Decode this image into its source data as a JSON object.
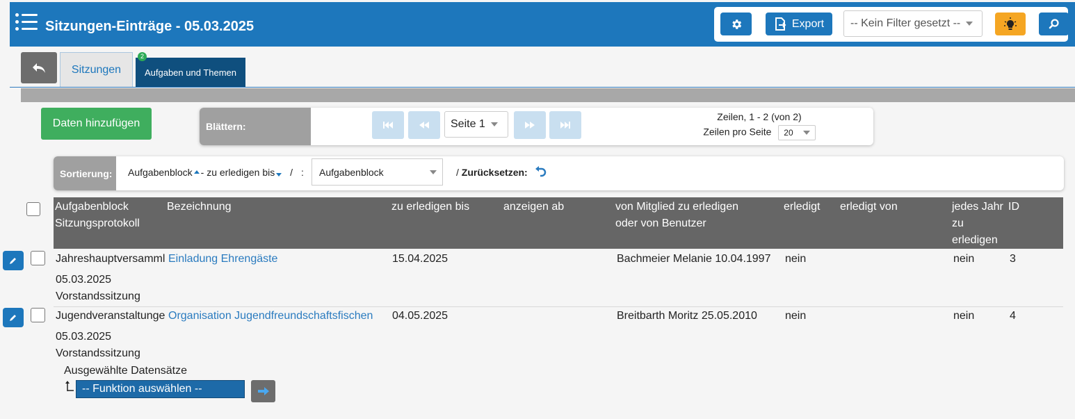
{
  "header": {
    "title": "Sitzungen-Einträge - 05.03.2025",
    "export_label": "Export",
    "filter_value": "-- Kein Filter gesetzt --"
  },
  "tabs": {
    "sitzungen": "Sitzungen",
    "aufgaben": "Aufgaben und Themen",
    "aufgaben_badge": "2"
  },
  "actions": {
    "add_label": "Daten hinzufügen"
  },
  "pager": {
    "label": "Blättern:",
    "page_select": "Seite 1",
    "rows_info": "Zeilen, 1 - 2 (von 2)",
    "rows_per_page_label": "Zeilen pro Seite",
    "rows_per_page": "20"
  },
  "sort": {
    "label": "Sortierung:",
    "field1": "Aufgabenblock",
    "field2": "- zu erledigen bis",
    "sep1": "/",
    "sep2": ":",
    "select_value": "Aufgabenblock",
    "reset_prefix": "/",
    "reset_label": "Zurücksetzen:"
  },
  "table": {
    "headers": {
      "aufgabenblock": "Aufgabenblock",
      "sitzungsprotokoll": "Sitzungsprotokoll",
      "bezeichnung": "Bezeichnung",
      "zu_erledigen": "zu erledigen bis",
      "anzeigen": "anzeigen ab",
      "mitglied1": "von Mitglied zu erledigen",
      "mitglied2": "oder von Benutzer",
      "erledigt": "erledigt",
      "erledigt_von": "erledigt von",
      "jedes1": "jedes Jahr",
      "jedes2": "zu",
      "jedes3": "erledigen",
      "id": "ID"
    },
    "rows": [
      {
        "block": "Jahreshauptversamml",
        "bezeichnung": "Einladung Ehrengäste",
        "date": "05.03.2025",
        "type": "Vorstandssitzung",
        "zu_erledigen": "15.04.2025",
        "mitglied": "Bachmeier Melanie 10.04.1997",
        "erledigt": "nein",
        "jedes_jahr": "nein",
        "id": "3"
      },
      {
        "block": "Jugendveranstaltunge",
        "bezeichnung": "Organisation Jugendfreundschaftsfischen",
        "date": "05.03.2025",
        "type": "Vorstandssitzung",
        "zu_erledigen": "04.05.2025",
        "mitglied": "Breitbarth Moritz 25.05.2010",
        "erledigt": "nein",
        "jedes_jahr": "nein",
        "id": "4"
      }
    ]
  },
  "bulk": {
    "label": "Ausgewählte Datensätze",
    "function_select": "-- Funktion auswählen --"
  },
  "icons": {
    "menu": "list-menu-icon",
    "settings": "gear-icon",
    "export": "file-export-icon",
    "bulb": "lightbulb-icon",
    "search": "search-icon",
    "back": "reply-back-icon",
    "reset": "undo-icon",
    "edit": "pencil-icon",
    "go": "arrow-right-icon"
  },
  "colors": {
    "primary": "#1d77bc",
    "success": "#3fae5e",
    "warning": "#f5a623",
    "header_dark": "#666666",
    "tab_active": "#0f4f7e"
  }
}
